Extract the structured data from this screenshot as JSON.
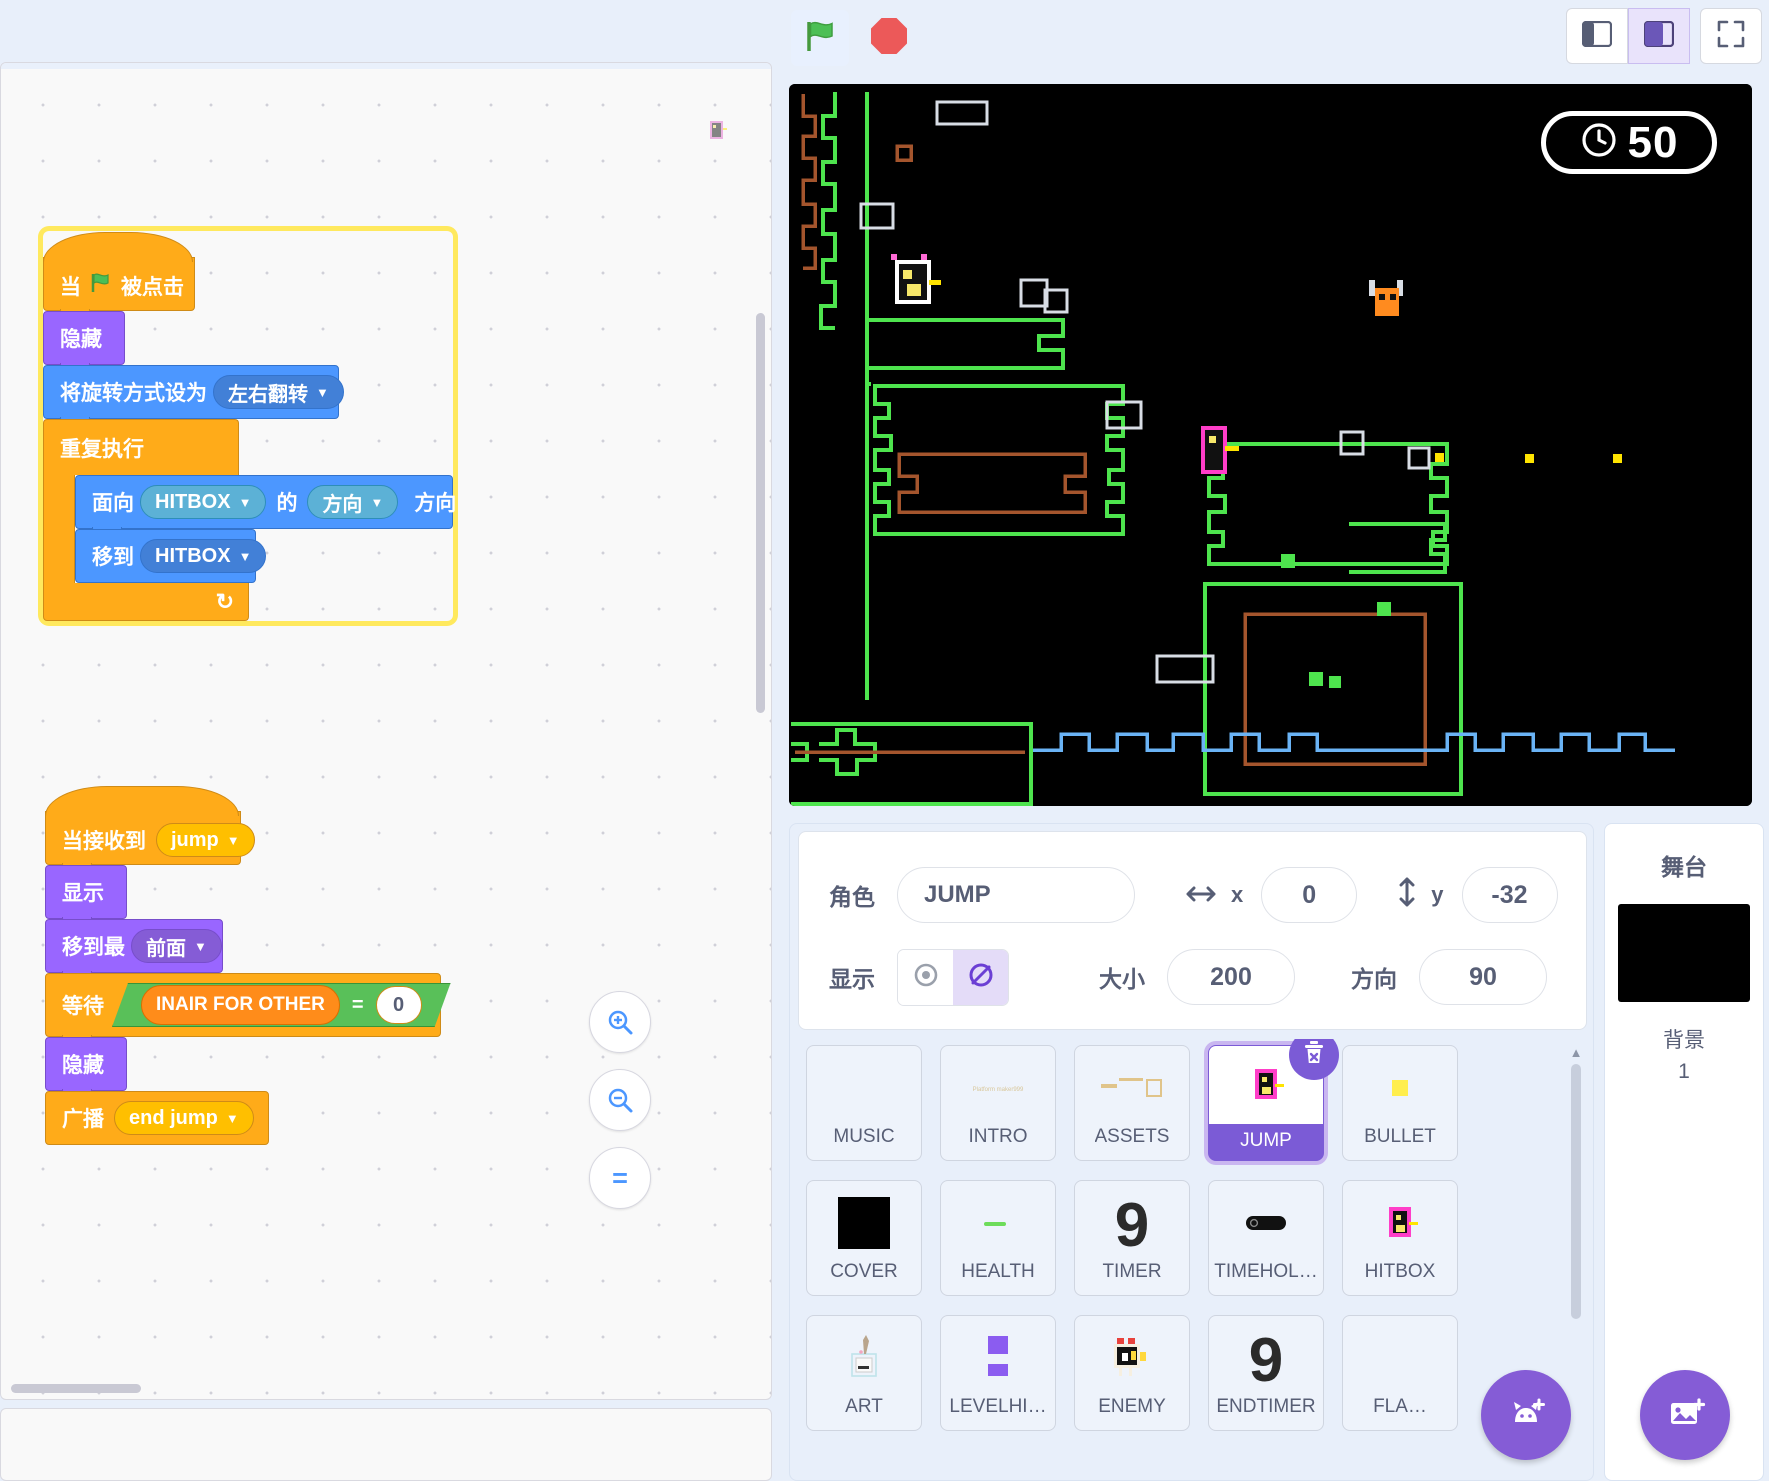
{
  "stage_controls": {
    "green_flag_icon": "green-flag-icon",
    "stop_icon": "stop-sign-icon",
    "layout_small_icon": "small-stage-layout-icon",
    "layout_large_icon": "large-stage-layout-icon",
    "fullscreen_icon": "fullscreen-icon"
  },
  "stage": {
    "timer_value": "50",
    "timer_icon": "clock-icon"
  },
  "scripts": {
    "script1": {
      "hat": {
        "pre": "当",
        "icon": "green-flag-icon",
        "post": "被点击"
      },
      "hide": "隐藏",
      "set_rotation": {
        "label": "将旋转方式设为",
        "value": "左右翻转"
      },
      "repeat": "重复执行",
      "point_towards": {
        "label": "面向",
        "target": "HITBOX",
        "of": "的",
        "prop": "方向",
        "suffix": "方向"
      },
      "goto": {
        "label": "移到",
        "target": "HITBOX"
      }
    },
    "script2": {
      "hat": {
        "label": "当接收到",
        "msg": "jump"
      },
      "show": "显示",
      "go_to_layer": {
        "label": "移到最",
        "value": "前面"
      },
      "wait_until": {
        "label": "等待",
        "var": "INAIR FOR OTHER",
        "op": "=",
        "value": "0"
      },
      "hide": "隐藏",
      "broadcast": {
        "label": "广播",
        "msg": "end jump"
      }
    }
  },
  "zoom_controls": {
    "zoom_in": "+",
    "zoom_out": "−",
    "zoom_reset": "="
  },
  "sprite_info": {
    "name_label": "角色",
    "name_value": "JUMP",
    "x_label": "x",
    "x_value": "0",
    "y_label": "y",
    "y_value": "-32",
    "show_label": "显示",
    "show_on_icon": "eye-visible-icon",
    "show_off_icon": "eye-hidden-icon",
    "size_label": "大小",
    "size_value": "200",
    "direction_label": "方向",
    "direction_value": "90"
  },
  "sprites": [
    {
      "name": "MUSIC",
      "thumb": "blank",
      "selected": false
    },
    {
      "name": "INTRO",
      "thumb": "text-tiny",
      "selected": false
    },
    {
      "name": "ASSETS",
      "thumb": "assets",
      "selected": false
    },
    {
      "name": "JUMP",
      "thumb": "player",
      "selected": true
    },
    {
      "name": "BULLET",
      "thumb": "bullet",
      "selected": false
    },
    {
      "name": "COVER",
      "thumb": "black",
      "selected": false
    },
    {
      "name": "HEALTH",
      "thumb": "greenbar",
      "selected": false
    },
    {
      "name": "TIMER",
      "thumb": "nine",
      "selected": false
    },
    {
      "name": "TIMEHOL…",
      "thumb": "pill",
      "selected": false
    },
    {
      "name": "HITBOX",
      "thumb": "player",
      "selected": false
    },
    {
      "name": "ART",
      "thumb": "art",
      "selected": false
    },
    {
      "name": "LEVELHI…",
      "thumb": "levelhint",
      "selected": false
    },
    {
      "name": "ENEMY",
      "thumb": "enemy",
      "selected": false
    },
    {
      "name": "ENDTIMER",
      "thumb": "nine",
      "selected": false
    },
    {
      "name": "FLA…",
      "thumb": "blank",
      "selected": false
    }
  ],
  "sprite_list": {
    "delete_icon": "trash-delete-icon",
    "add_sprite_icon": "add-sprite-cat-icon"
  },
  "stage_pane": {
    "title": "舞台",
    "backdrop_label": "背景",
    "backdrop_count": "1",
    "add_backdrop_icon": "add-backdrop-image-icon"
  },
  "colors": {
    "events": "#ffab19",
    "looks": "#9966ff",
    "motion": "#4c97ff",
    "control": "#ffab19",
    "operators": "#59c059",
    "variables": "#ff8c1a",
    "accent": "#855cd6",
    "glow": "#ffe95e"
  }
}
